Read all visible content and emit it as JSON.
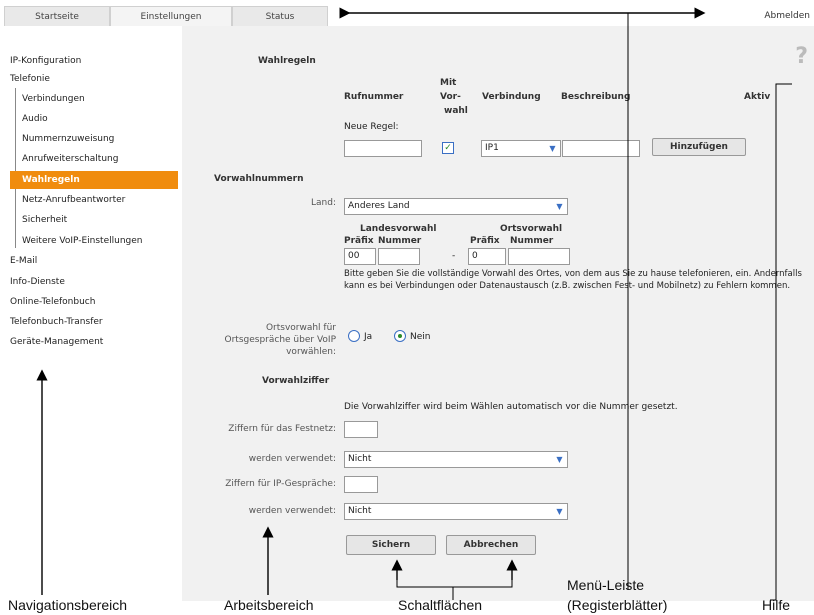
{
  "tabs": [
    {
      "label": "Startseite"
    },
    {
      "label": "Einstellungen"
    },
    {
      "label": "Status"
    }
  ],
  "logout_label": "Abmelden",
  "help_glyph": "?",
  "nav": {
    "ip": "IP-Konfiguration",
    "tel": "Telefonie",
    "sub": [
      "Verbindungen",
      "Audio",
      "Nummernzuweisung",
      "Anrufweiterschaltung",
      "Wahlregeln",
      "Netz-Anrufbeantworter",
      "Sicherheit",
      "Weitere VoIP-Einstellungen"
    ],
    "email": "E-Mail",
    "info": "Info-Dienste",
    "online": "Online-Telefonbuch",
    "transfer": "Telefonbuch-Transfer",
    "mgmt": "Geräte-Management"
  },
  "wahlregeln": {
    "section": "Wahlregeln",
    "col_rufnummer": "Rufnummer",
    "col_mitvorwahl": [
      "Mit",
      "Vor-",
      "wahl"
    ],
    "col_verbindung": "Verbindung",
    "col_beschreibung": "Beschreibung",
    "col_aktiv": "Aktiv",
    "new_rule": "Neue Regel:",
    "connection_value": "IP1",
    "add_button": "Hinzufügen"
  },
  "vorwahl": {
    "section": "Vorwahlnummern",
    "land_label": "Land:",
    "land_value": "Anderes Land",
    "landesvorwahl": "Landesvorwahl",
    "ortsvorwahl": "Ortsvorwahl",
    "praefix": "Präfix",
    "nummer": "Nummer",
    "land_prefix": "00",
    "dash": "-",
    "ort_prefix": "0",
    "info": "Bitte geben Sie die vollständige Vorwahl des Ortes, von dem aus Sie zu hause telefonieren, ein. Andernfalls kann es bei Verbindungen oder Datenaustausch (z.B. zwischen Fest- und Mobilnetz) zu Fehlern kommen.",
    "ortsgespraech_label": [
      "Ortsvorwahl für",
      "Ortsgespräche über VoIP",
      "vorwählen:"
    ],
    "ja": "Ja",
    "nein": "Nein"
  },
  "ziffer": {
    "section": "Vorwahlziffer",
    "info": "Die Vorwahlziffer wird beim Wählen automatisch vor die Nummer gesetzt.",
    "festnetz_label": "Ziffern für das Festnetz:",
    "used_label_1": "werden verwendet:",
    "used_value_1": "Nicht",
    "ip_label": "Ziffern für IP-Gespräche:",
    "used_label_2": "werden verwendet:",
    "used_value_2": "Nicht"
  },
  "buttons": {
    "save": "Sichern",
    "cancel": "Abbrechen"
  },
  "captions": {
    "nav": "Navigationsbereich",
    "work": "Arbeitsbereich",
    "buttons": "Schaltflächen",
    "menu_1": "Menü-Leiste",
    "menu_2": "(Registerblätter)",
    "help": "Hilfe"
  }
}
